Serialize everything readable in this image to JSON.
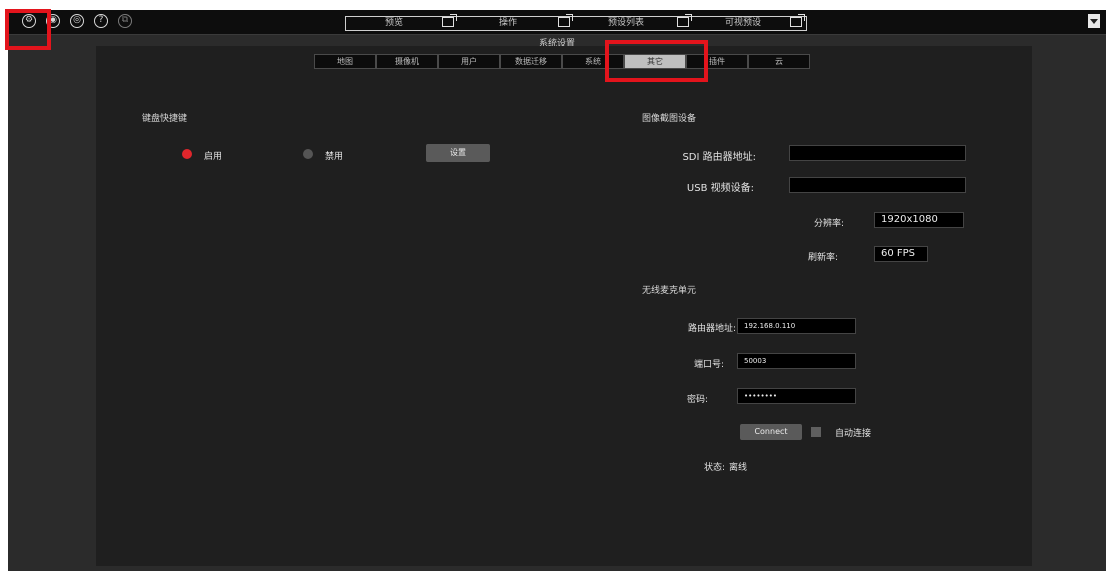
{
  "toolbar": {
    "icons": [
      "settings-icon",
      "camera-icon",
      "preset-icon",
      "help-icon",
      "layers-icon"
    ],
    "tabs": [
      {
        "label": "预览"
      },
      {
        "label": "操作"
      },
      {
        "label": "预设列表"
      },
      {
        "label": "可视预设"
      }
    ]
  },
  "page_title": "系统设置",
  "subtabs": [
    "地图",
    "摄像机",
    "用户",
    "数据迁移",
    "系统",
    "其它",
    "插件",
    "云"
  ],
  "keyboard": {
    "section_title": "键盘快捷键",
    "enable_label": "启用",
    "disable_label": "禁用",
    "set_button": "设置"
  },
  "capture": {
    "section_title": "图像截图设备",
    "sdi_label": "SDI 路由器地址:",
    "sdi_value": "",
    "usb_label": "USB 视频设备:",
    "usb_value": "",
    "resolution_label": "分辨率:",
    "resolution_value": "1920x1080",
    "refresh_label": "刷新率:",
    "refresh_value": "60 FPS"
  },
  "wireless": {
    "section_title": "无线麦克单元",
    "router_label": "路由器地址:",
    "router_value": "192.168.0.110",
    "port_label": "端口号:",
    "port_value": "50003",
    "password_label": "密码:",
    "password_value": "••••••••",
    "connect_button": "Connect",
    "auto_connect_label": "自动连接",
    "status_label": "状态:",
    "status_value": "离线"
  },
  "colors": {
    "highlight": "#e3141c",
    "radio_on": "#e0262c",
    "radio_off": "#555555"
  }
}
